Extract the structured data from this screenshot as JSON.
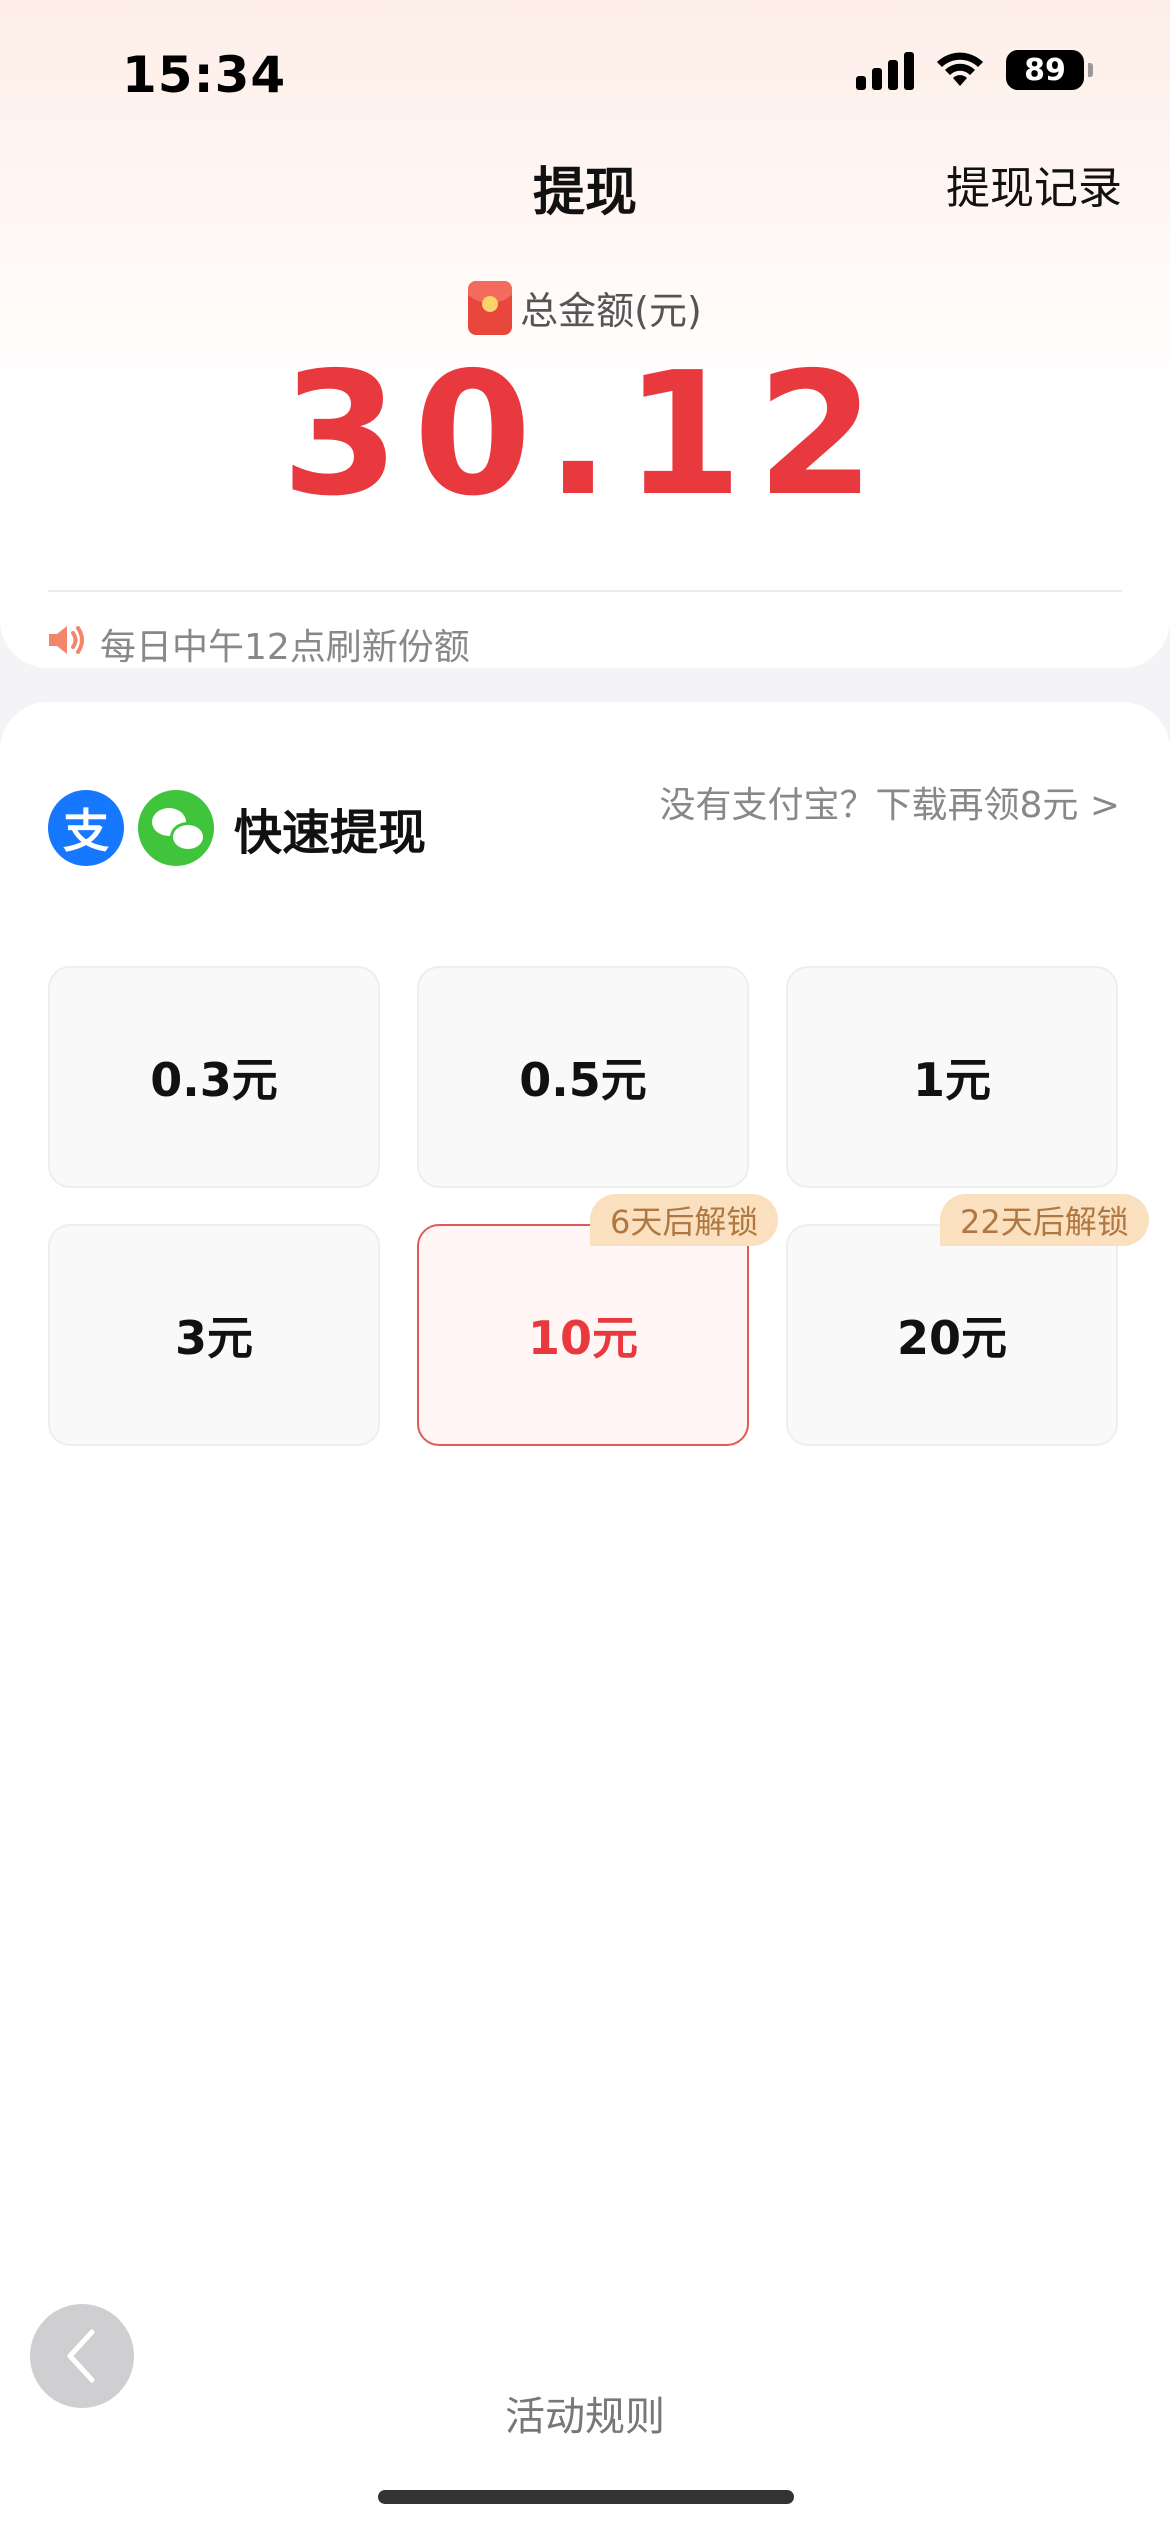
{
  "status_bar": {
    "time": "15:34",
    "battery": "89"
  },
  "nav": {
    "title": "提现",
    "records_label": "提现记录"
  },
  "balance": {
    "label": "总金额(元)",
    "amount": "30.12"
  },
  "notice": {
    "text": "每日中午12点刷新份额"
  },
  "withdraw": {
    "method_title": "快速提现",
    "alipay_glyph": "支",
    "no_alipay_link": "没有支付宝？下载再领8元 >",
    "amounts": [
      {
        "label": "0.3元",
        "selected": false,
        "badge": ""
      },
      {
        "label": "0.5元",
        "selected": false,
        "badge": ""
      },
      {
        "label": "1元",
        "selected": false,
        "badge": ""
      },
      {
        "label": "3元",
        "selected": false,
        "badge": ""
      },
      {
        "label": "10元",
        "selected": true,
        "badge": "6天后解锁"
      },
      {
        "label": "20元",
        "selected": false,
        "badge": "22天后解锁"
      }
    ]
  },
  "footer": {
    "rules_label": "活动规则"
  },
  "colors": {
    "accent_red": "#e8393f",
    "alipay_blue": "#1677ff",
    "wechat_green": "#3fc43c",
    "badge_bg": "#fbe0bf",
    "badge_text": "#b07840"
  },
  "icons": [
    "signal-icon",
    "wifi-icon",
    "battery-icon",
    "redpacket-icon",
    "speaker-icon",
    "alipay-icon",
    "wechat-icon",
    "back-arrow-icon"
  ]
}
